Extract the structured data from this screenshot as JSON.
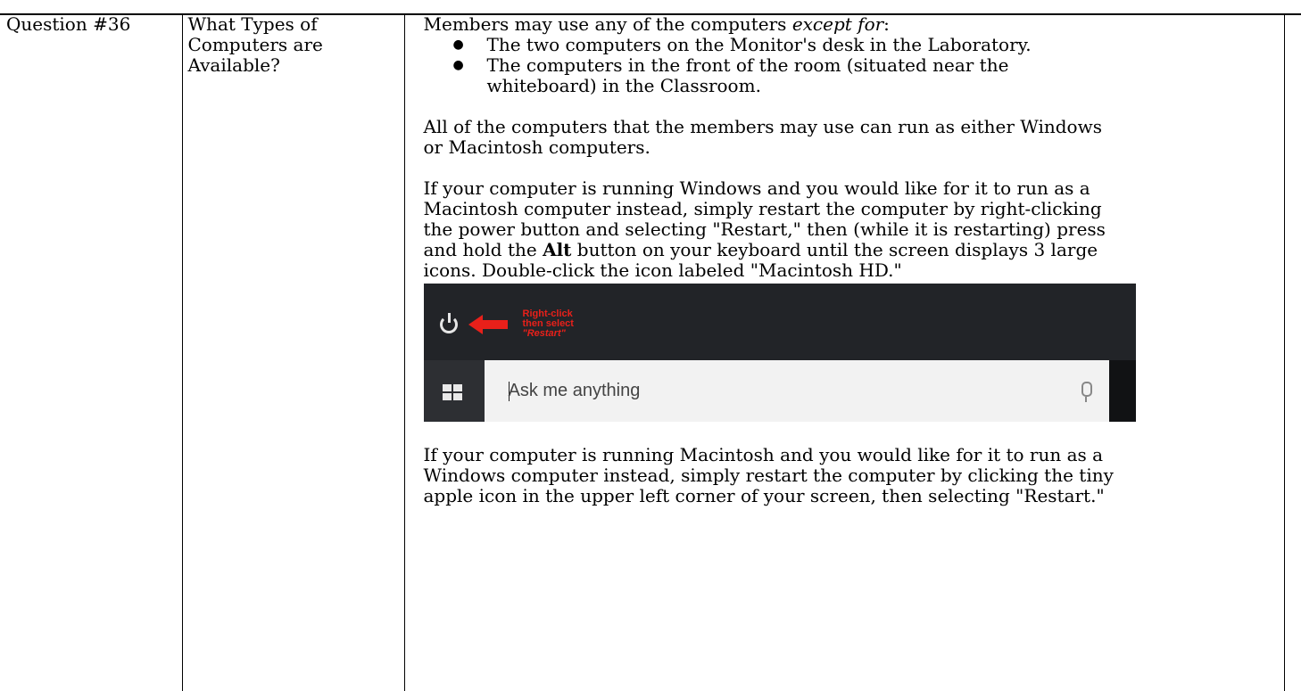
{
  "row": {
    "number": "Question #36",
    "question_lines": [
      "What Types of",
      "Computers are",
      "Available?"
    ]
  },
  "answer": {
    "intro_prefix": "Members may use any of the computers ",
    "intro_emphasis": "except for",
    "intro_suffix": ":",
    "exceptions": [
      {
        "text": "The two computers on the Monitor's desk in the Laboratory."
      },
      {
        "lines": [
          "The computers in the front of the room (situated near the",
          "whiteboard) in the Classroom."
        ]
      }
    ],
    "paragraph_2_lines": [
      "All of the computers that the members may use can run as either Windows",
      "or Macintosh computers."
    ],
    "paragraph_3_lines_before_bold": [
      "If your computer is running Windows and you would like for it to run as a",
      "Macintosh computer instead, simply restart the computer by right-clicking",
      "the power button and selecting \"Restart,\" then (while it is restarting) press"
    ],
    "paragraph_3_bold_prefix": "and hold the ",
    "paragraph_3_bold": "Alt",
    "paragraph_3_bold_suffix": " button on your keyboard until the screen displays 3 large",
    "paragraph_3_last_line": "icons.  Double-click the icon labeled \"Macintosh HD.\"",
    "paragraph_4_lines": [
      "If your computer is running Macintosh and you would like for it to run as a",
      "Windows computer instead, simply restart the computer by clicking the tiny",
      "apple icon in the upper left corner of your screen, then selecting \"Restart.\""
    ]
  },
  "screenshot": {
    "annotation_lines": [
      "Right-click",
      "then select",
      "\"Restart\""
    ],
    "search_placeholder": "Ask me anything",
    "icons": [
      "power-icon",
      "left-arrow-icon",
      "windows-logo-icon",
      "microphone-icon"
    ],
    "annotation_color": "#e8201a",
    "taskbar_color": "#1e2024"
  }
}
